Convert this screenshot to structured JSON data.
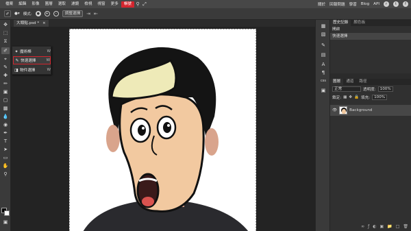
{
  "menubar": {
    "items": [
      "檔案",
      "編輯",
      "影像",
      "圖層",
      "選取",
      "濾鏡",
      "檢視",
      "視窗",
      "更多"
    ],
    "active_item": "帳號",
    "right_items": [
      "關於",
      "回報問題",
      "學習",
      "Blog",
      "API"
    ],
    "accent": "#d4252e"
  },
  "options": {
    "mode_label": "模式:",
    "modes": [
      "●",
      "+",
      "-"
    ],
    "refine_button": "調整選擇",
    "arrows": [
      "⇥",
      "⇤"
    ]
  },
  "document": {
    "tab_title": "大頭貼.psd *",
    "close": "×"
  },
  "flyout": {
    "items": [
      {
        "label": "魔術棒",
        "key": "W",
        "icon": "✦"
      },
      {
        "label": "快速選擇",
        "key": "W",
        "icon": "✎"
      },
      {
        "label": "物件選擇",
        "key": "W",
        "icon": "◨"
      }
    ]
  },
  "history_panel": {
    "tabs": [
      "歷史記錄",
      "顏色板"
    ],
    "items": [
      "開啟",
      "快速選擇"
    ]
  },
  "layers_panel": {
    "tabs": [
      "圖層",
      "通道",
      "路徑"
    ],
    "blend_mode": "正常",
    "opacity_label": "透明度:",
    "opacity_value": "100%",
    "lock_label": "鎖定:",
    "fill_label": "填充:",
    "fill_value": "100%",
    "layer_name": "Background"
  },
  "icon_strip": {
    "css_label": "css"
  }
}
